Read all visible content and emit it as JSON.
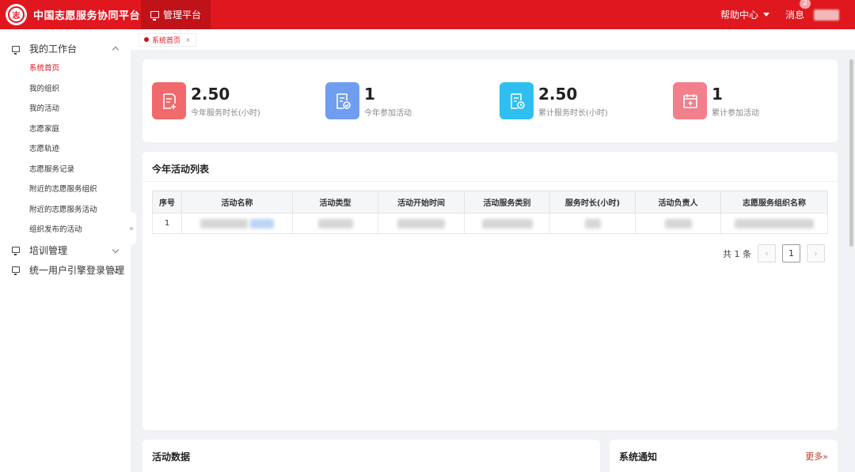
{
  "header": {
    "app_title": "中国志愿服务协同平台",
    "logo_mark": "志",
    "nav_tab": "管理平台",
    "help_label": "帮助中心",
    "messages_label": "消息",
    "messages_badge": "2"
  },
  "sidebar": {
    "group1": "我的工作台",
    "items": [
      "系统首页",
      "我的组织",
      "我的活动",
      "志愿家庭",
      "志愿轨迹",
      "志愿服务记录",
      "附近的志愿服务组织",
      "附近的志愿服务活动",
      "组织发布的活动"
    ],
    "group2": "培训管理",
    "group3": "统一用户引擎登录管理",
    "collapse_glyph": "«"
  },
  "tags": {
    "home": "系统首页",
    "close": "×"
  },
  "stats": [
    {
      "value": "2.50",
      "label": "今年服务时长(小时)",
      "color": "#f0696d"
    },
    {
      "value": "1",
      "label": "今年参加活动",
      "color": "#6f9ef0"
    },
    {
      "value": "2.50",
      "label": "累计服务时长(小时)",
      "color": "#2ebeef"
    },
    {
      "value": "1",
      "label": "累计参加活动",
      "color": "#f27f8c"
    }
  ],
  "activity_list": {
    "title": "今年活动列表",
    "columns": [
      "序号",
      "活动名称",
      "活动类型",
      "活动开始时间",
      "活动服务类别",
      "服务时长(小时)",
      "活动负责人",
      "志愿服务组织名称"
    ],
    "rows": [
      {
        "index": "1"
      }
    ],
    "total_label": "共 1 条",
    "current_page": "1",
    "prev": "‹",
    "next": "›"
  },
  "activity_data": {
    "title": "活动数据"
  },
  "notice": {
    "title": "系统通知",
    "more": "更多»"
  }
}
